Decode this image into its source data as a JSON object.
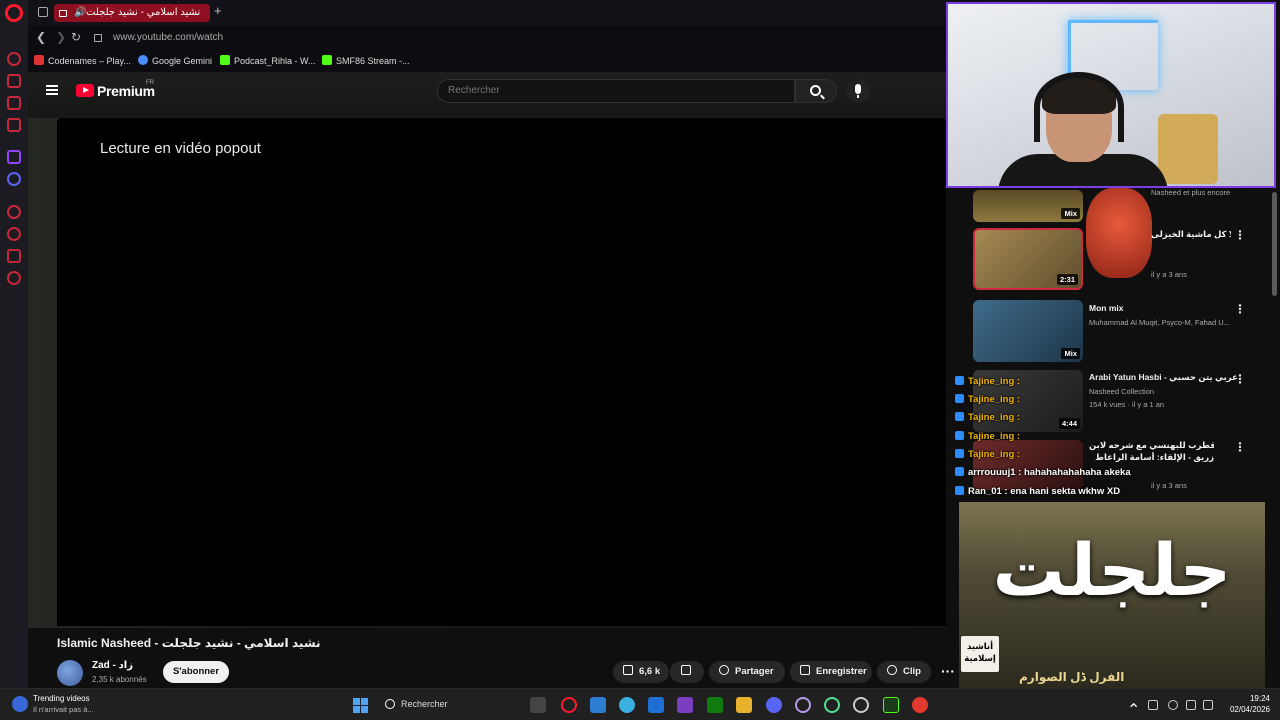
{
  "browser": {
    "tab_title": "نشيد اسلامي - نشيد جلجلت",
    "new_tab_symbol": "+",
    "url": "www.youtube.com/watch",
    "bookmarks": [
      "Codenames – Play...",
      "Google Gemini",
      "Podcast_Rihla - W...",
      "SMF86 Stream -..."
    ]
  },
  "youtube": {
    "brand": "Premium",
    "country": "FR",
    "search_placeholder": "Rechercher",
    "player_message": "Lecture en vidéo popout",
    "video_title": "Islamic Nasheed - نشيد اسلامي - نشيد جلجلت",
    "channel_name": "Zad - زاد",
    "channel_subs": "2,35 k abonnés",
    "subscribe_label": "S'abonner",
    "like_count": "6,6 k",
    "share_label": "Partager",
    "save_label": "Enregistrer",
    "clip_label": "Clip",
    "more_symbol": "···"
  },
  "recommendations": [
    {
      "title": "",
      "subtitle": "Nasheed et plus encore",
      "badge": "Mix"
    },
    {
      "title": "ألا كل ماشية الخيزلى",
      "subtitle": "il y a 3 ans",
      "badge": "2:31"
    },
    {
      "title": "Mon mix",
      "subtitle": "Muhammad Al Muqit, Psyco-M, Fahad U...",
      "badge": "Mix"
    },
    {
      "title": "Arabi Yatun Hasbi - عربي يتن حسبي",
      "subtitle": "Nasheed Collection",
      "meta": "154 k vues · il y a 1 an",
      "badge": "4:44"
    },
    {
      "title": "نظم ملك قطرب للبهنسي مع شرحه لابن",
      "subtitle": "زريق - الإلقاء: أسامة الراعاط",
      "meta": "il y a 3 ans",
      "badge": ""
    }
  ],
  "chat": [
    {
      "user": "Tajine_ing :",
      "msg": ""
    },
    {
      "user": "Tajine_ing :",
      "msg": ""
    },
    {
      "user": "Tajine_ing :",
      "msg": ""
    },
    {
      "user": "Tajine_ing :",
      "msg": ""
    },
    {
      "user": "Tajine_ing :",
      "msg": ""
    },
    {
      "user": "arrrouuuj1 :",
      "msg": "hahahahahahaha akeka"
    },
    {
      "user": "Ran_01 :",
      "msg": "ena hani sekta wkhw XD"
    }
  ],
  "overlay": {
    "big_text": "جلجلت",
    "tag_line1": "أناشيد",
    "tag_line2": "إسلامية",
    "bottom_text": "الفرل ڈل الصوارم"
  },
  "taskbar": {
    "trend_title": "Trending videos",
    "trend_sub": "Il n'arrivait pas à...",
    "search_label": "Rechercher",
    "time": "19:24",
    "date": "02/04/2026"
  },
  "colors": {
    "accent": "#ff0033",
    "tab_active": "#8e1020",
    "webcam_border": "#7b3fe4",
    "chat_user": "#f0b400"
  }
}
